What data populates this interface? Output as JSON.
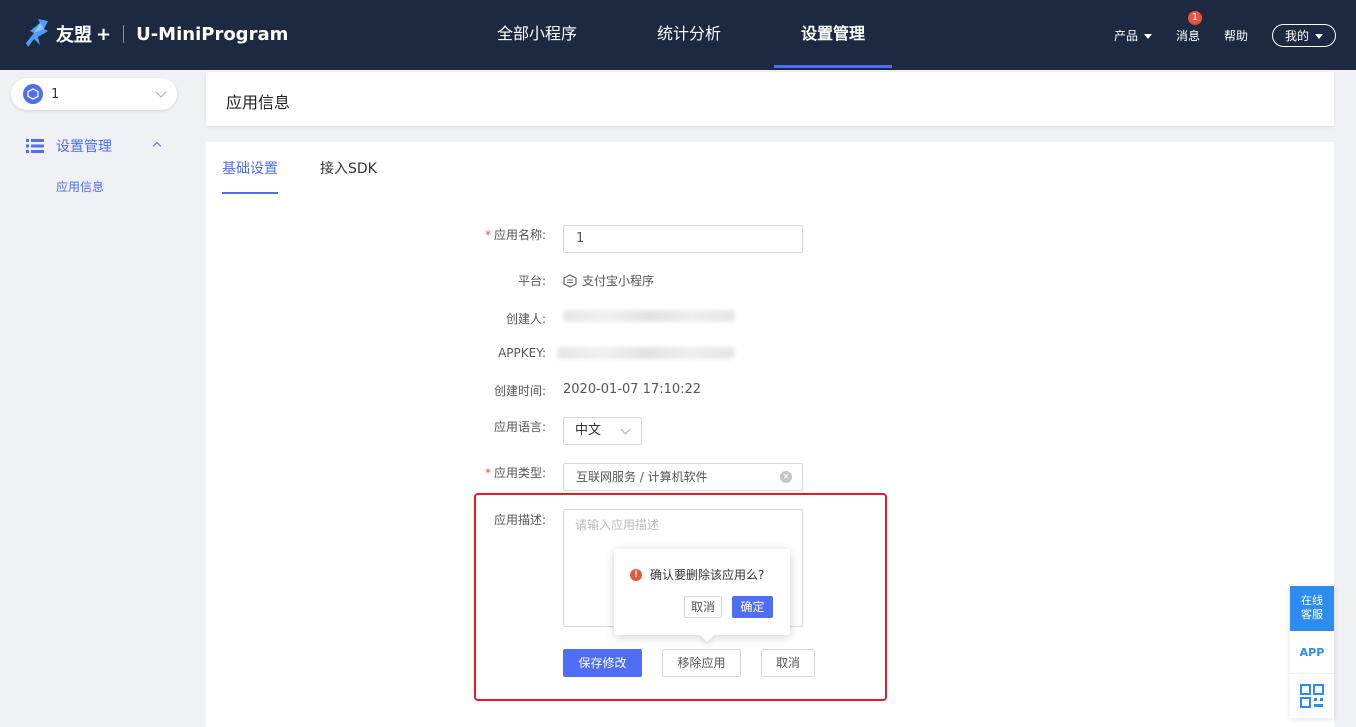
{
  "header": {
    "brand": "友盟",
    "brand_plus": "+",
    "product": "U-MiniProgram",
    "nav": [
      "全部小程序",
      "统计分析",
      "设置管理"
    ],
    "active_nav": "设置管理",
    "right": {
      "product_menu": "产品",
      "messages": "消息",
      "message_count": "1",
      "help": "帮助",
      "mine": "我的"
    }
  },
  "sidebar": {
    "app_selector_value": "1",
    "group_label": "设置管理",
    "sub_item": "应用信息"
  },
  "page": {
    "title": "应用信息",
    "tabs": [
      "基础设置",
      "接入SDK"
    ],
    "active_tab": "基础设置"
  },
  "form": {
    "app_name_label": "应用名称:",
    "app_name_value": "1",
    "platform_label": "平台:",
    "platform_value": "支付宝小程序",
    "creator_label": "创建人:",
    "appkey_label": "APPKEY:",
    "created_time_label": "创建时间:",
    "created_time_value": "2020-01-07 17:10:22",
    "language_label": "应用语言:",
    "language_value": "中文",
    "type_label": "应用类型:",
    "type_value": "互联网服务 / 计算机软件",
    "desc_label": "应用描述:",
    "desc_placeholder": "请输入应用描述",
    "required_mark": "*"
  },
  "buttons": {
    "save": "保存修改",
    "remove": "移除应用",
    "cancel": "取消"
  },
  "popconfirm": {
    "warn_icon": "!",
    "message": "确认要删除该应用么?",
    "cancel": "取消",
    "confirm": "确定"
  },
  "float_tools": {
    "customer_service": "在线客服",
    "app": "APP"
  },
  "colors": {
    "topbar": "#1c2940",
    "accent": "#4f6df5",
    "highlight": "#e8192c"
  }
}
